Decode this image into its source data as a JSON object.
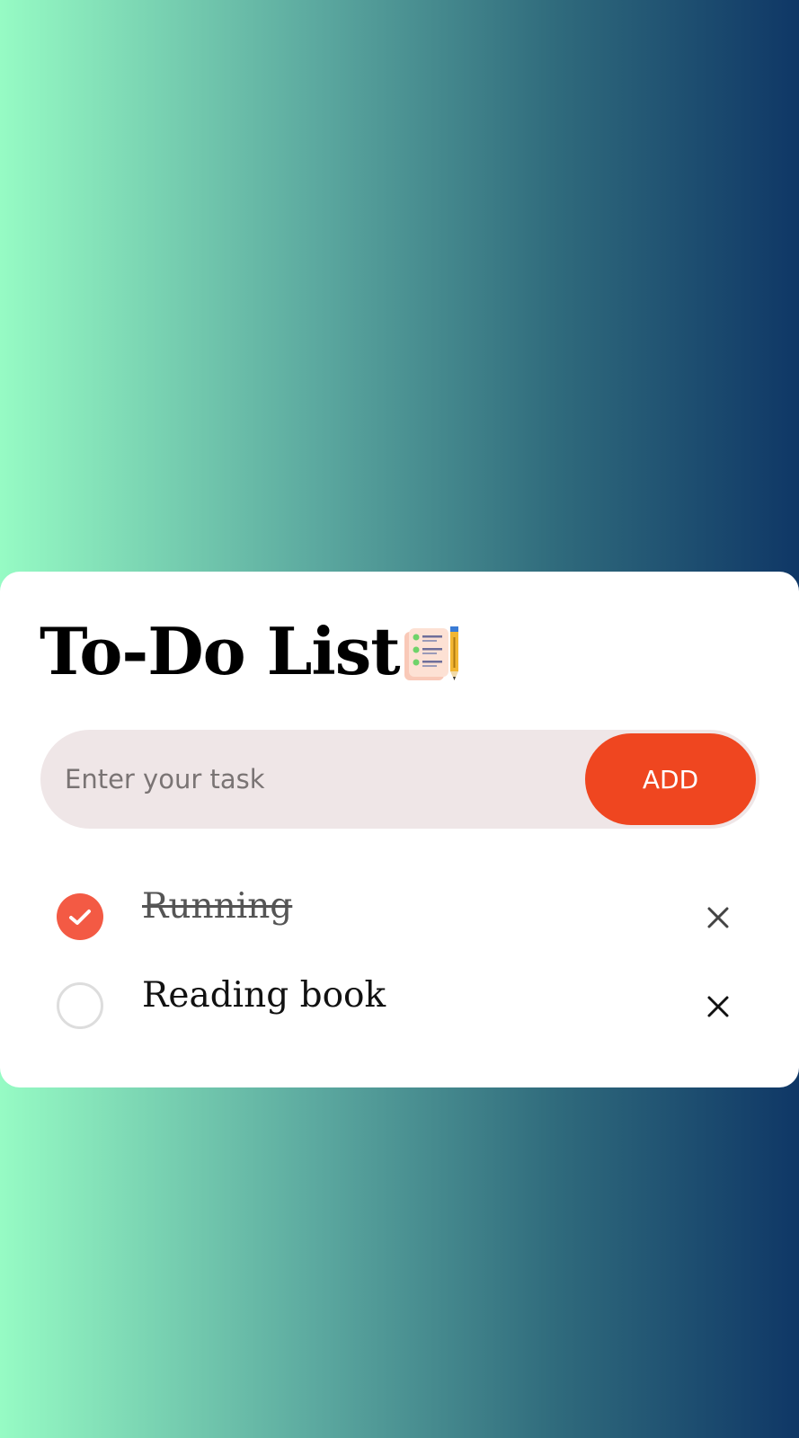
{
  "app": {
    "title": "To-Do List",
    "title_icon": "checklist-pencil-icon"
  },
  "input": {
    "placeholder": "Enter your task",
    "value": ""
  },
  "add_button": {
    "label": "ADD"
  },
  "tasks": [
    {
      "label": "Running",
      "completed": true
    },
    {
      "label": "Reading book",
      "completed": false
    }
  ],
  "colors": {
    "accent": "#ef4620",
    "check_done": "#f35a44",
    "input_bg": "#efe6e7",
    "gradient_start": "#96fbc4",
    "gradient_end": "#0f3766"
  }
}
